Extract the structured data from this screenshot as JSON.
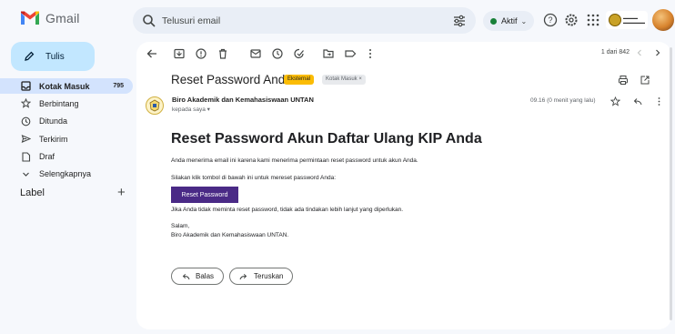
{
  "app": {
    "name": "Gmail"
  },
  "search": {
    "placeholder": "Telusuri email"
  },
  "status": {
    "label": "Aktif"
  },
  "sidebar": {
    "compose_label": "Tulis",
    "items": [
      {
        "label": "Kotak Masuk",
        "count": "795",
        "icon": "inbox-icon",
        "active": true
      },
      {
        "label": "Berbintang",
        "icon": "star-icon"
      },
      {
        "label": "Ditunda",
        "icon": "clock-icon"
      },
      {
        "label": "Terkirim",
        "icon": "send-icon"
      },
      {
        "label": "Draf",
        "icon": "draft-icon"
      },
      {
        "label": "Selengkapnya",
        "icon": "chevron-down-icon"
      }
    ],
    "labels_heading": "Label",
    "labels_add": "+"
  },
  "toolbar": {
    "pager_text": "1 dari 842"
  },
  "email": {
    "subject": "Reset Password Anda",
    "tags": [
      {
        "label": "Eksternal"
      },
      {
        "label": "Kotak Masuk ×"
      }
    ],
    "sender": "Biro Akademik dan Kemahasiswaan UNTAN",
    "recipient": "kepada saya ▾",
    "time": "09.16 (0 menit yang lalu)",
    "heading": "Reset Password Akun Daftar Ulang KIP Anda",
    "paragraphs": [
      "Anda menerima email ini karena kami menerima permintaan reset password untuk akun Anda.",
      "Silakan klik tombol di bawah ini untuk mereset password Anda:"
    ],
    "button_label": "Reset Password",
    "after_button": "Jika Anda tidak meminta reset password, tidak ada tindakan lebih lanjut yang diperlukan.",
    "signoff": [
      "Salam,",
      "Biro Akademik dan Kemahasiswaan UNTAN."
    ]
  },
  "actions": {
    "reply_label": "Balas",
    "forward_label": "Teruskan"
  },
  "colors": {
    "accent": "#c2e7ff",
    "active_nav": "#d3e3fd",
    "button": "#4a2a86",
    "external_tag": "#fbbc04",
    "online": "#188038"
  }
}
